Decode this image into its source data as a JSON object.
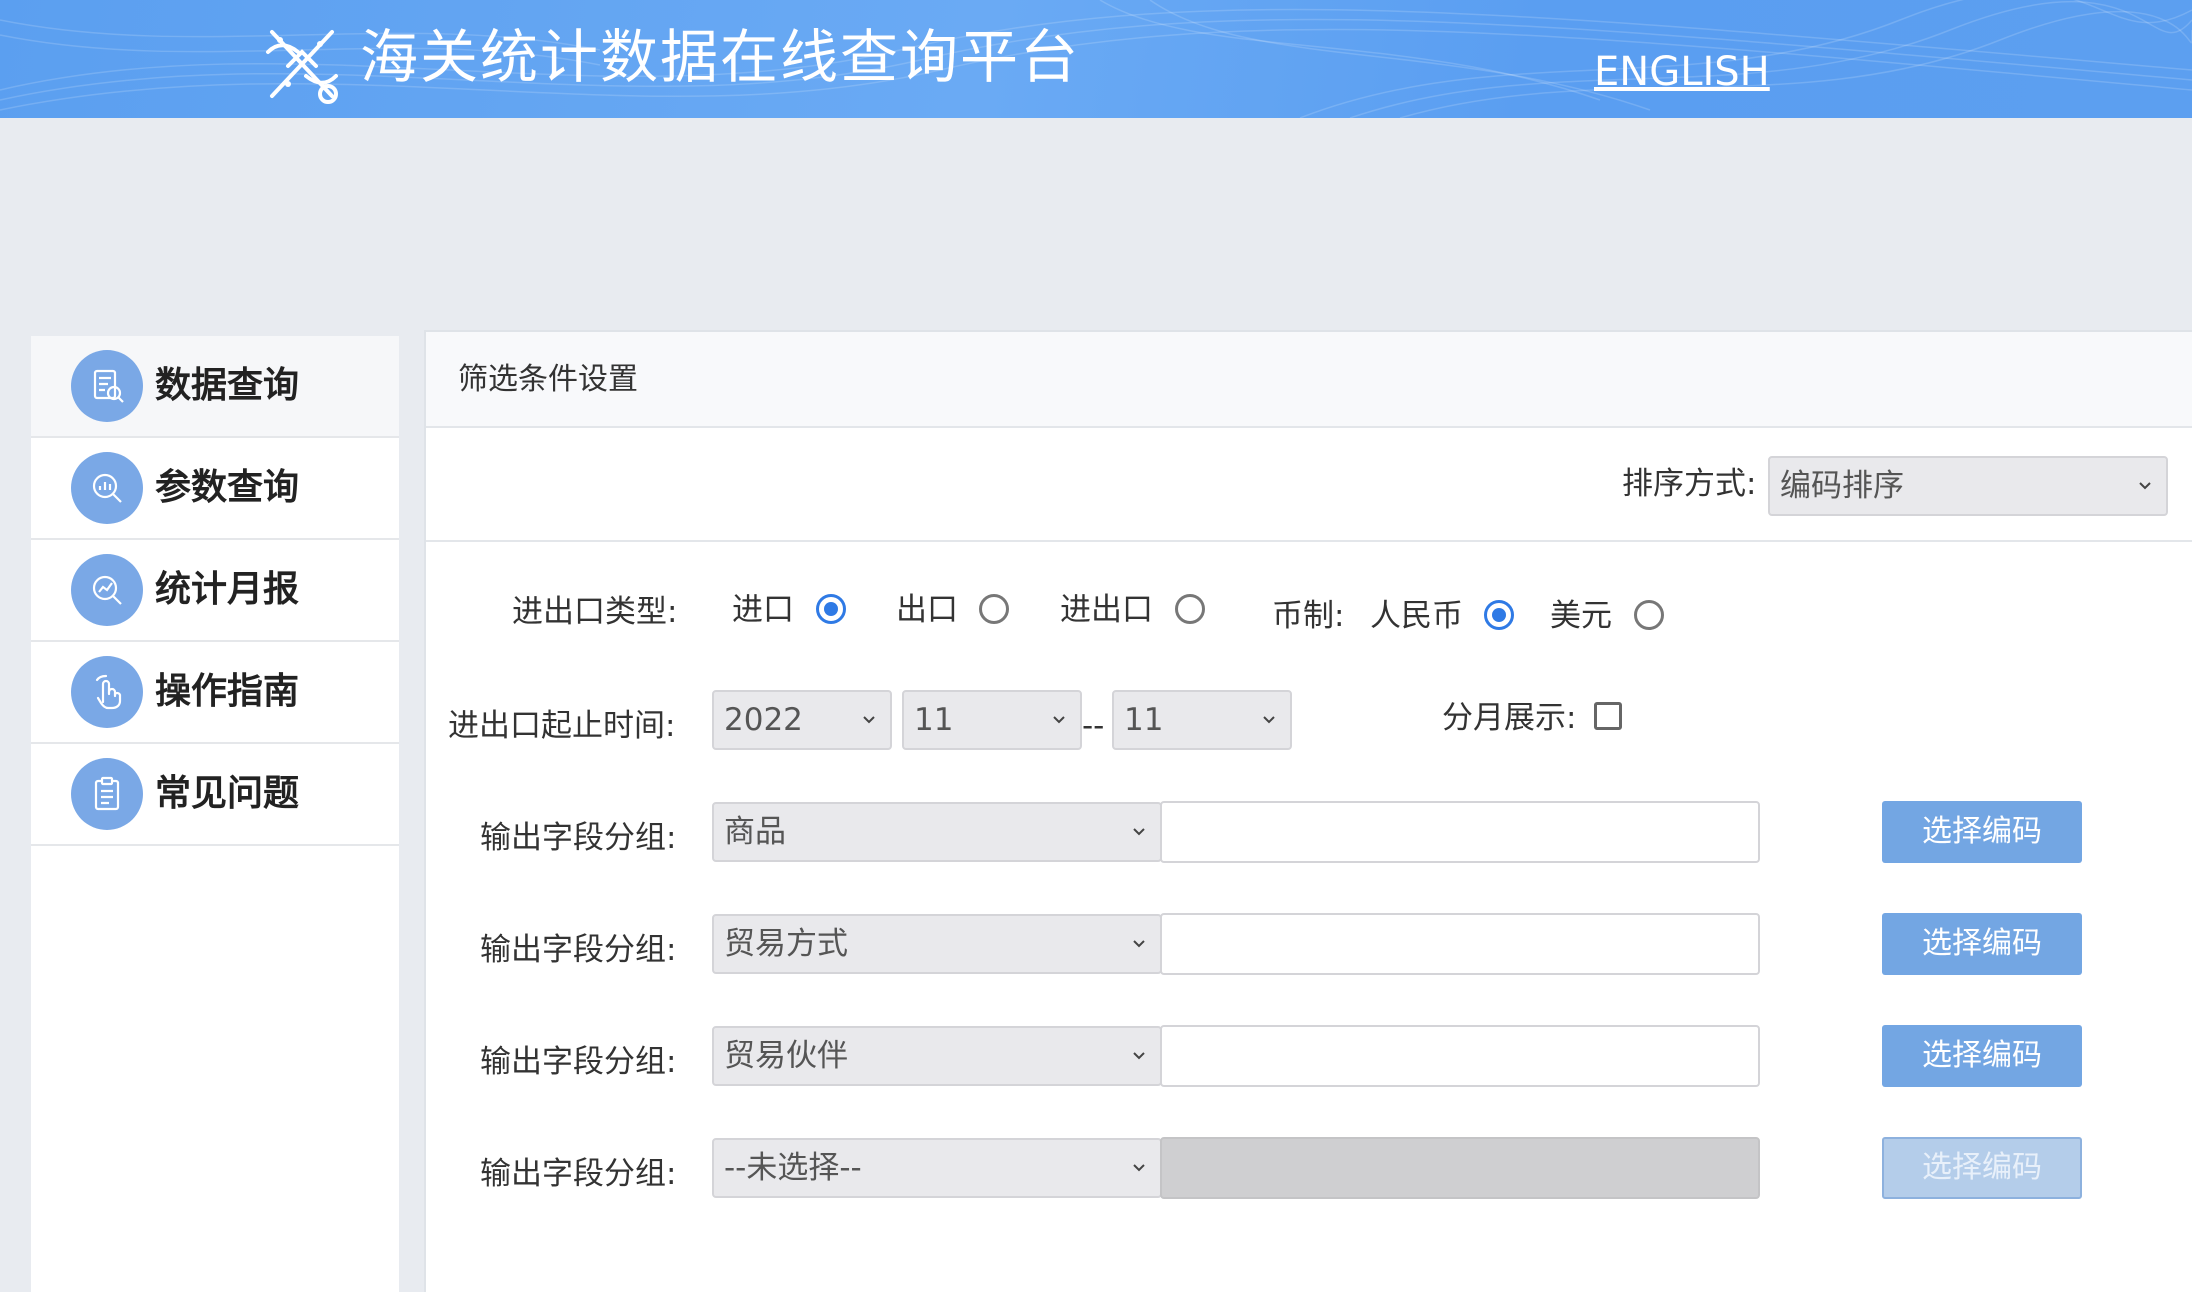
{
  "header": {
    "title": "海关统计数据在线查询平台",
    "english_link": "ENGLISH"
  },
  "sidebar": {
    "items": [
      {
        "label": "数据查询",
        "icon": "data-query-icon",
        "active": true
      },
      {
        "label": "参数查询",
        "icon": "param-query-icon",
        "active": false
      },
      {
        "label": "统计月报",
        "icon": "monthly-report-icon",
        "active": false
      },
      {
        "label": "操作指南",
        "icon": "guide-icon",
        "active": false
      },
      {
        "label": "常见问题",
        "icon": "faq-icon",
        "active": false
      }
    ]
  },
  "panel": {
    "title": "筛选条件设置",
    "sort": {
      "label": "排序方式:",
      "value": "编码排序"
    },
    "trade_type": {
      "label": "进出口类型:",
      "options": [
        "进口",
        "出口",
        "进出口"
      ],
      "selected": "进口"
    },
    "currency": {
      "label": "币制:",
      "options": [
        "人民币",
        "美元"
      ],
      "selected": "人民币"
    },
    "period": {
      "label": "进出口起止时间:",
      "year": "2022",
      "start_month": "11",
      "separator": "--",
      "end_month": "11"
    },
    "monthly_display": {
      "label": "分月展示:",
      "checked": false
    },
    "groups": [
      {
        "label": "输出字段分组:",
        "value": "商品",
        "input": "",
        "button": "选择编码",
        "disabled": false
      },
      {
        "label": "输出字段分组:",
        "value": "贸易方式",
        "input": "",
        "button": "选择编码",
        "disabled": false
      },
      {
        "label": "输出字段分组:",
        "value": "贸易伙伴",
        "input": "",
        "button": "选择编码",
        "disabled": false
      },
      {
        "label": "输出字段分组:",
        "value": "--未选择--",
        "input": "",
        "button": "选择编码",
        "disabled": true
      }
    ]
  },
  "colors": {
    "header_blue": "#5b9ff0",
    "radio_checked": "#2f7ae5",
    "button_blue": "#73a6e3",
    "icon_circle": "#7aa8e6"
  }
}
